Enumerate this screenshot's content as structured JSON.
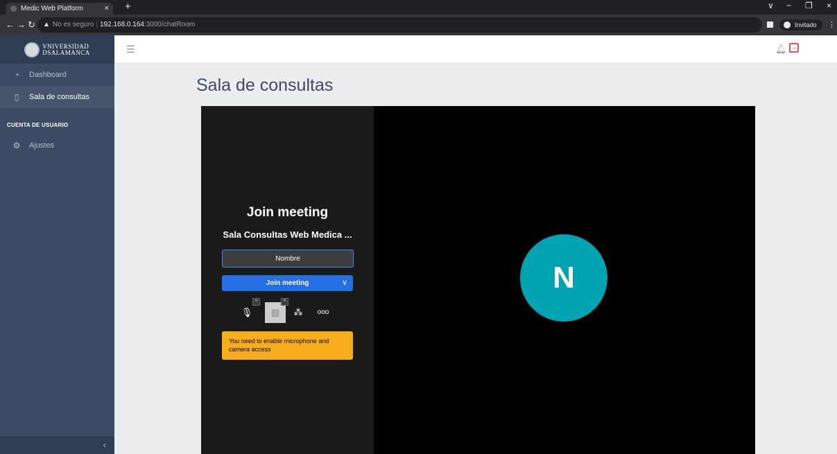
{
  "browser": {
    "tab_title": "Medic Web Platform",
    "tab_close": "×",
    "new_tab": "+",
    "security_label": "No es seguro",
    "url_host": "192.168.0.164",
    "url_path": ":3000/chatRoom",
    "profile_label": "Invitado",
    "window_controls": [
      "∨",
      "−",
      "❐",
      "×"
    ]
  },
  "sidebar": {
    "brand_line1": "VNIVERSIDAD",
    "brand_line2": "DSALAMANCA",
    "items": [
      {
        "label": "Dashboard",
        "icon": "speedometer-icon"
      },
      {
        "label": "Sala de consultas",
        "icon": "book-icon"
      }
    ],
    "section_title": "CUENTA DE USUARIO",
    "settings_item": {
      "label": "Ajustes",
      "icon": "gear-icon"
    },
    "toggler": "‹"
  },
  "header": {
    "menu_icon": "☰",
    "bell_icon": "bell-icon",
    "logout_icon": "logout-icon"
  },
  "page": {
    "title": "Sala de consultas"
  },
  "meeting": {
    "title": "Join meeting",
    "room_name": "Sala Consultas Web Medica ...",
    "name_placeholder": "Nombre",
    "join_label": "Join meeting",
    "warning": "You need to enable microphone and camera access",
    "avatar_initial": "N",
    "colors": {
      "avatar": "#00a3b0",
      "join": "#246fe5",
      "warning": "#f8ae1a"
    }
  }
}
